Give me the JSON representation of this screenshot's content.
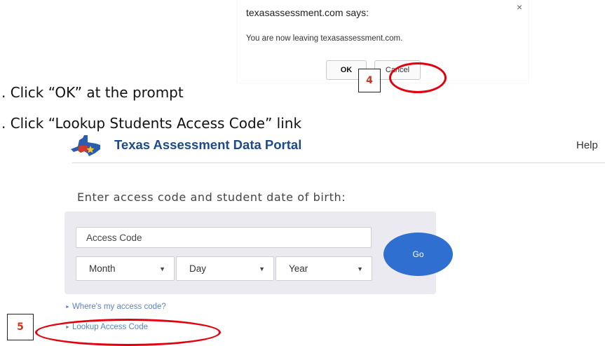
{
  "steps": [
    {
      "text": ".  Click “OK”  at the prompt"
    },
    {
      "text": ".  Click “Lookup Students Access Code” link"
    }
  ],
  "dialog": {
    "title": "texasassessment.com says:",
    "close": "×",
    "message": "You are now leaving texasassessment.com.",
    "ok_label": "OK",
    "cancel_label": "Cancel"
  },
  "markers": {
    "step4": "4",
    "step5": "5"
  },
  "colors": {
    "annotation_red": "#e3000f",
    "marker_number": "#d33020",
    "portal_blue": "#1c4a8c",
    "go_button": "#2f6fcf",
    "link": "#5a83c2",
    "form_bg": "#eaeaf0"
  },
  "portal": {
    "logo_icon": "texas-flag-map-logo",
    "title": "Texas Assessment Data Portal",
    "help": "Help",
    "prompt": "Enter access code and student date of birth:",
    "access_placeholder": "Access Code",
    "month": "Month",
    "day": "Day",
    "year": "Year",
    "caret": "▼",
    "go": "Go",
    "link_arrow": "►",
    "wheres_code": "Where's my access code?",
    "lookup_code": "Lookup Access Code"
  }
}
